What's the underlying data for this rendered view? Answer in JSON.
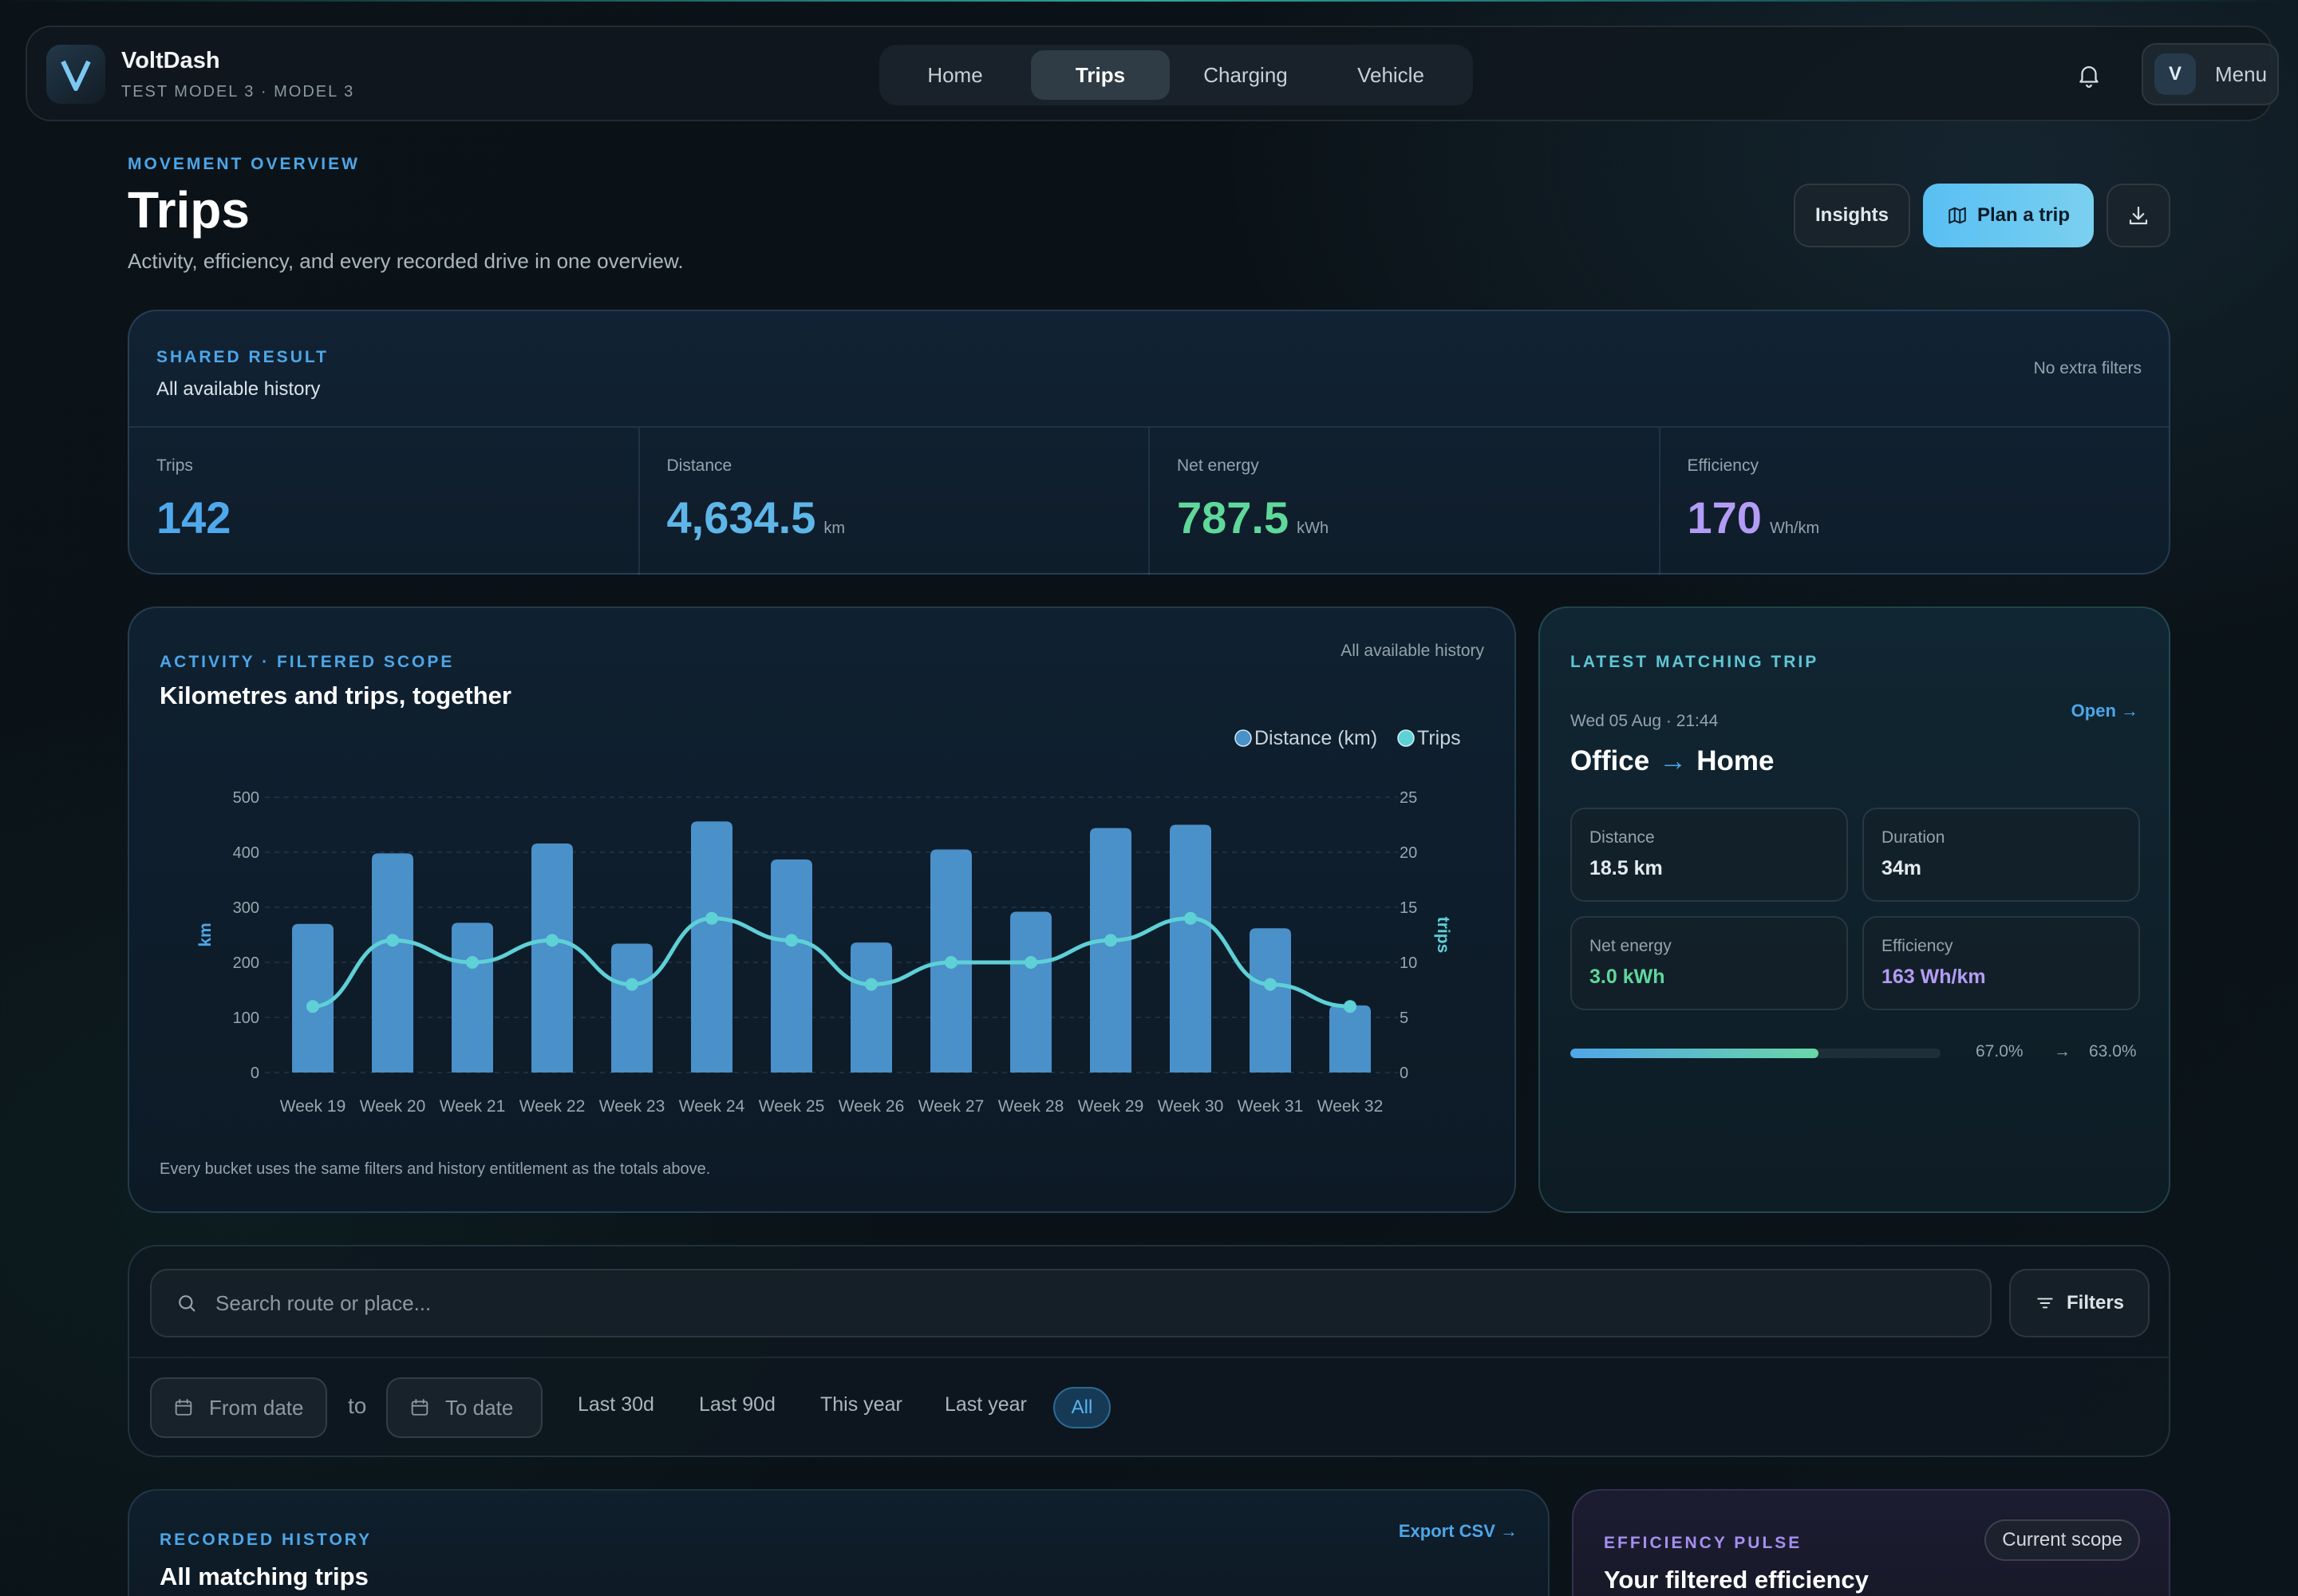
{
  "app": {
    "brand": "VoltDash",
    "subtitle": "TEST MODEL 3 · MODEL 3",
    "logo_letter": "V",
    "avatar_letter": "V",
    "menu_label": "Menu"
  },
  "nav": {
    "tabs": [
      {
        "label": "Home",
        "active": false
      },
      {
        "label": "Trips",
        "active": true
      },
      {
        "label": "Charging",
        "active": false
      },
      {
        "label": "Vehicle",
        "active": false
      }
    ]
  },
  "header": {
    "eyebrow": "MOVEMENT OVERVIEW",
    "title": "Trips",
    "subtitle": "Activity, efficiency, and every recorded drive in one overview.",
    "insights_label": "Insights",
    "plan_label": "Plan a trip"
  },
  "shared": {
    "eyebrow": "SHARED RESULT",
    "subtitle": "All available history",
    "right_note": "No extra filters",
    "stats": [
      {
        "label": "Trips",
        "value": "142",
        "unit": "",
        "color": "#4fa8ec"
      },
      {
        "label": "Distance",
        "value": "4,634.5",
        "unit": "km",
        "color": "#5eb6e8"
      },
      {
        "label": "Net energy",
        "value": "787.5",
        "unit": "kWh",
        "color": "#5fd89a"
      },
      {
        "label": "Efficiency",
        "value": "170",
        "unit": "Wh/km",
        "color": "#b39cf5"
      }
    ]
  },
  "activity": {
    "eyebrow": "ACTIVITY · FILTERED SCOPE",
    "title": "Kilometres and trips, together",
    "scope_note": "All available history",
    "footnote": "Every bucket uses the same filters and history entitlement as the totals above."
  },
  "chart_data": {
    "type": "bar",
    "categories": [
      "Week 19",
      "Week 20",
      "Week 21",
      "Week 22",
      "Week 23",
      "Week 24",
      "Week 25",
      "Week 26",
      "Week 27",
      "Week 28",
      "Week 29",
      "Week 30",
      "Week 31",
      "Week 32"
    ],
    "series": [
      {
        "name": "Distance (km)",
        "type": "bar",
        "axis": "left",
        "color": "#4a90c9",
        "values": [
          270,
          398,
          272,
          416,
          234,
          456,
          387,
          236,
          405,
          292,
          444,
          450,
          262,
          122
        ]
      },
      {
        "name": "Trips",
        "type": "line",
        "axis": "right",
        "color": "#5ed0d6",
        "values": [
          6,
          12,
          10,
          12,
          8,
          14,
          12,
          8,
          10,
          10,
          12,
          14,
          8,
          6
        ]
      }
    ],
    "ylabel": "km",
    "y2label": "trips",
    "ylim": [
      0,
      500
    ],
    "y2lim": [
      0,
      25
    ],
    "yticks": [
      0,
      100,
      200,
      300,
      400,
      500
    ],
    "y2ticks": [
      0,
      5,
      10,
      15,
      20,
      25
    ],
    "grid": true,
    "legend": "top-right"
  },
  "latest": {
    "eyebrow": "LATEST MATCHING TRIP",
    "date": "Wed 05 Aug · 21:44",
    "open_label": "Open →",
    "from": "Office",
    "arrow": "→",
    "to": "Home",
    "metrics": [
      {
        "label": "Distance",
        "value": "18.5 km",
        "color": "#e4ebf0"
      },
      {
        "label": "Duration",
        "value": "34m",
        "color": "#e4ebf0"
      },
      {
        "label": "Net energy",
        "value": "3.0 kWh",
        "color": "#5fd89a"
      },
      {
        "label": "Efficiency",
        "value": "163 Wh/km",
        "color": "#b39cf5"
      }
    ],
    "soc_start": "67.0%",
    "soc_arrow": "→",
    "soc_end": "63.0%",
    "soc_start_fraction": 0.67,
    "soc_end_fraction": 0.63
  },
  "search": {
    "placeholder": "Search route or place...",
    "filters_label": "Filters",
    "from_date": "From date",
    "to_label": "to",
    "to_date": "To date",
    "ranges": [
      "Last 30d",
      "Last 90d",
      "This year",
      "Last year"
    ],
    "all_label": "All"
  },
  "history": {
    "eyebrow": "RECORDED HISTORY",
    "title": "All matching trips",
    "export_label": "Export CSV →"
  },
  "pulse": {
    "eyebrow": "EFFICIENCY PULSE",
    "title": "Your filtered efficiency",
    "chip": "Current scope"
  },
  "icons": {
    "bell": "bell-icon",
    "plan": "map-icon",
    "download": "download-icon",
    "search": "search-icon",
    "filters": "filter-icon",
    "calendar": "calendar-icon"
  }
}
